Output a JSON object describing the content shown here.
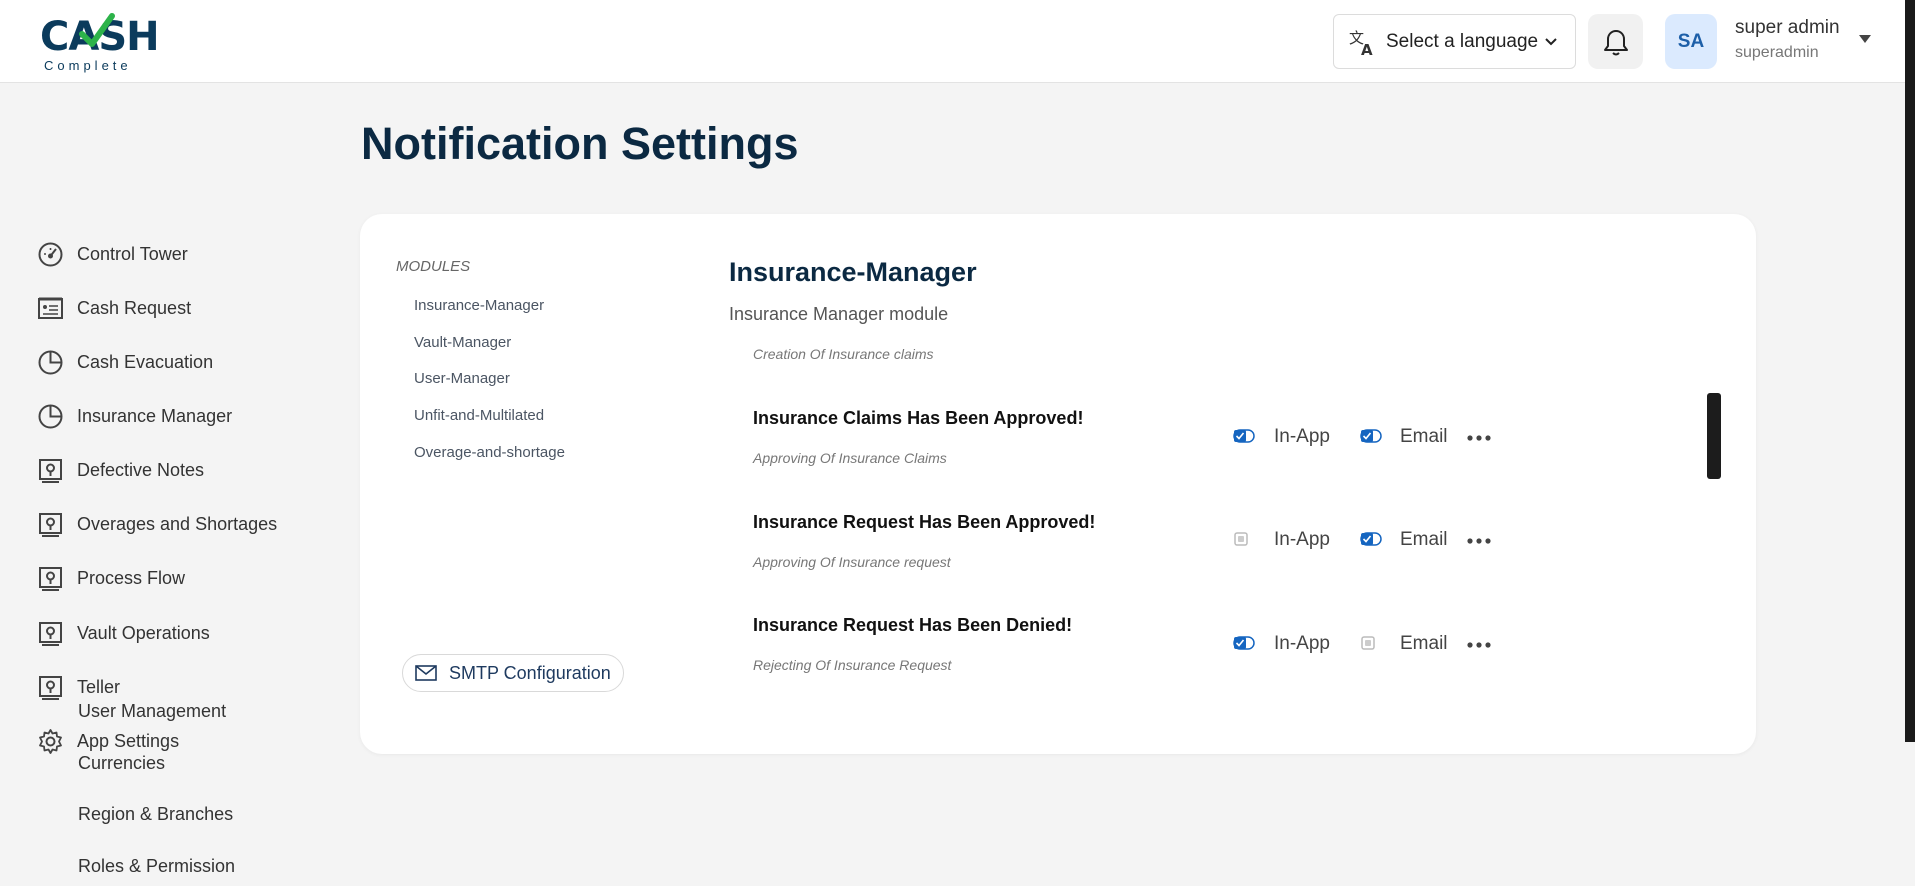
{
  "logo": {
    "main": "CASH",
    "sub": "Complete"
  },
  "header": {
    "language_select_label": "Select a language",
    "avatar_initials": "SA",
    "user_name": "super admin",
    "user_handle": "superadmin"
  },
  "sidebar": {
    "items": [
      {
        "label": "Control Tower",
        "icon": "gauge-icon"
      },
      {
        "label": "Cash Request",
        "icon": "list-card-icon"
      },
      {
        "label": "Cash Evacuation",
        "icon": "pie-chart-icon"
      },
      {
        "label": "Insurance Manager",
        "icon": "pie-chart-icon"
      },
      {
        "label": "Defective Notes",
        "icon": "location-card-icon"
      },
      {
        "label": "Overages and Shortages",
        "icon": "location-card-icon"
      },
      {
        "label": "Process Flow",
        "icon": "location-card-icon"
      },
      {
        "label": "Vault Operations",
        "icon": "location-card-icon"
      },
      {
        "label": "Teller",
        "icon": "location-card-icon"
      },
      {
        "label": "App Settings",
        "icon": "gear-icon"
      }
    ],
    "subitems": [
      {
        "label": "User Management"
      },
      {
        "label": "Currencies"
      },
      {
        "label": "Region & Branches"
      },
      {
        "label": "Roles & Permission"
      }
    ]
  },
  "page": {
    "title": "Notification Settings"
  },
  "modules": {
    "heading": "MODULES",
    "items": [
      {
        "label": "Insurance-Manager"
      },
      {
        "label": "Vault-Manager"
      },
      {
        "label": "User-Manager"
      },
      {
        "label": "Unfit-and-Multilated"
      },
      {
        "label": "Overage-and-shortage"
      }
    ],
    "smtp_label": "SMTP Configuration"
  },
  "section": {
    "title": "Insurance-Manager",
    "description": "Insurance Manager module",
    "subtitle": "Creation Of Insurance claims"
  },
  "notifications": [
    {
      "title": "Insurance Claims Has Been Approved!",
      "subtitle": "Approving Of Insurance Claims",
      "in_app": true,
      "email": true
    },
    {
      "title": "Insurance Request Has Been Approved!",
      "subtitle": "Approving Of Insurance request",
      "in_app": false,
      "email": true
    },
    {
      "title": "Insurance Request Has Been Denied!",
      "subtitle": "Rejecting Of Insurance Request",
      "in_app": true,
      "email": false
    }
  ],
  "labels": {
    "in_app": "In-App",
    "email": "Email"
  },
  "colors": {
    "accent": "#1565c0",
    "title": "#0b2942",
    "brand_green": "#2db34a"
  }
}
